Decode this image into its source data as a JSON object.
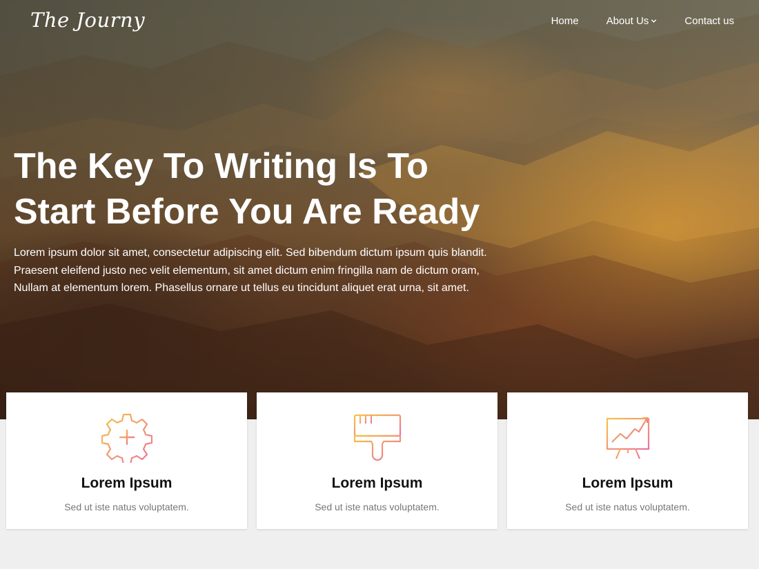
{
  "brand": {
    "logo_text": "The Journy"
  },
  "nav": {
    "items": [
      {
        "label": "Home",
        "has_dropdown": false
      },
      {
        "label": "About Us",
        "has_dropdown": true
      },
      {
        "label": "Contact us",
        "has_dropdown": false
      }
    ]
  },
  "hero": {
    "heading_line1": "The Key To Writing Is To",
    "heading_line2": "Start Before You Are Ready",
    "lead_line1": "Lorem ipsum dolor sit amet, consectetur adipiscing elit. Sed bibendum dictum ipsum quis blandit.",
    "lead_line2": "Praesent eleifend justo nec velit elementum, sit amet dictum enim fringilla nam de dictum oram,",
    "lead_line3": "Nullam at elementum lorem. Phasellus ornare ut tellus eu tincidunt aliquet erat urna, sit amet."
  },
  "features": [
    {
      "icon": "gear-plus-icon",
      "title": "Lorem Ipsum",
      "text": "Sed ut iste natus voluptatem."
    },
    {
      "icon": "paint-brush-icon",
      "title": "Lorem Ipsum",
      "text": "Sed ut iste natus voluptatem."
    },
    {
      "icon": "chart-presentation-icon",
      "title": "Lorem Ipsum",
      "text": "Sed ut iste natus voluptatem."
    }
  ],
  "colors": {
    "icon_gradient_start": "#f6c244",
    "icon_gradient_end": "#ec6fa0",
    "page_background": "#efefef"
  }
}
